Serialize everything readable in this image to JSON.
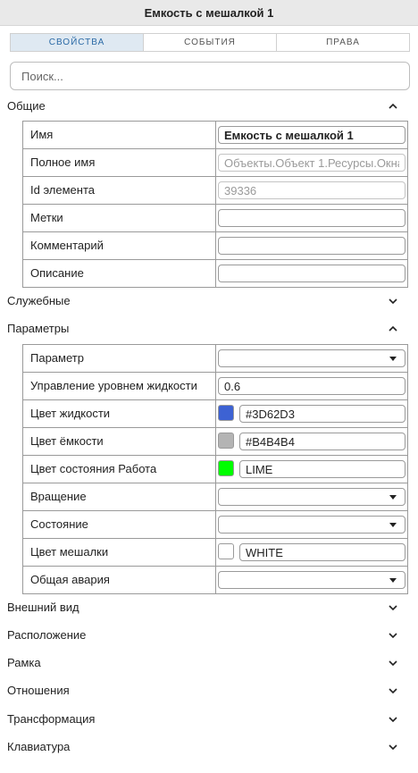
{
  "window": {
    "title": "Емкость с мешалкой 1"
  },
  "tabs": [
    {
      "label": "СВОЙСТВА",
      "active": true
    },
    {
      "label": "СОБЫТИЯ",
      "active": false
    },
    {
      "label": "ПРАВА",
      "active": false
    }
  ],
  "search": {
    "placeholder": "Поиск..."
  },
  "sections": {
    "general": {
      "title": "Общие",
      "expanded": true,
      "rows": {
        "name": {
          "label": "Имя",
          "value": "Емкость с мешалкой 1"
        },
        "full_name": {
          "label": "Полное имя",
          "value": "Объекты.Объект 1.Ресурсы.Окна"
        },
        "element_id": {
          "label": "Id элемента",
          "value": "39336"
        },
        "tags": {
          "label": "Метки",
          "value": ""
        },
        "comment": {
          "label": "Комментарий",
          "value": ""
        },
        "description": {
          "label": "Описание",
          "value": ""
        }
      }
    },
    "service": {
      "title": "Служебные",
      "expanded": false
    },
    "parameters": {
      "title": "Параметры",
      "expanded": true,
      "rows": {
        "parameter": {
          "label": "Параметр",
          "value": ""
        },
        "level_control": {
          "label": "Управление уровнем жидкости",
          "value": "0.6"
        },
        "liquid_color": {
          "label": "Цвет жидкости",
          "value": "#3D62D3",
          "swatch": "#3D62D3"
        },
        "tank_color": {
          "label": "Цвет ёмкости",
          "value": "#B4B4B4",
          "swatch": "#B4B4B4"
        },
        "work_state_color": {
          "label": "Цвет состояния Работа",
          "value": "LIME",
          "swatch": "#00FF00"
        },
        "rotation": {
          "label": "Вращение",
          "value": ""
        },
        "state": {
          "label": "Состояние",
          "value": ""
        },
        "mixer_color": {
          "label": "Цвет мешалки",
          "value": "WHITE",
          "swatch": "#FFFFFF"
        },
        "general_alarm": {
          "label": "Общая авария",
          "value": ""
        }
      }
    },
    "appearance": {
      "title": "Внешний вид",
      "expanded": false
    },
    "position": {
      "title": "Расположение",
      "expanded": false
    },
    "frame": {
      "title": "Рамка",
      "expanded": false
    },
    "relations": {
      "title": "Отношения",
      "expanded": false
    },
    "transform": {
      "title": "Трансформация",
      "expanded": false
    },
    "keyboard": {
      "title": "Клавиатура",
      "expanded": false
    }
  },
  "colors": {
    "accent": "#2B6AA6",
    "active_tab_bg": "#DFE9F2",
    "border": "#9A9A9A"
  }
}
